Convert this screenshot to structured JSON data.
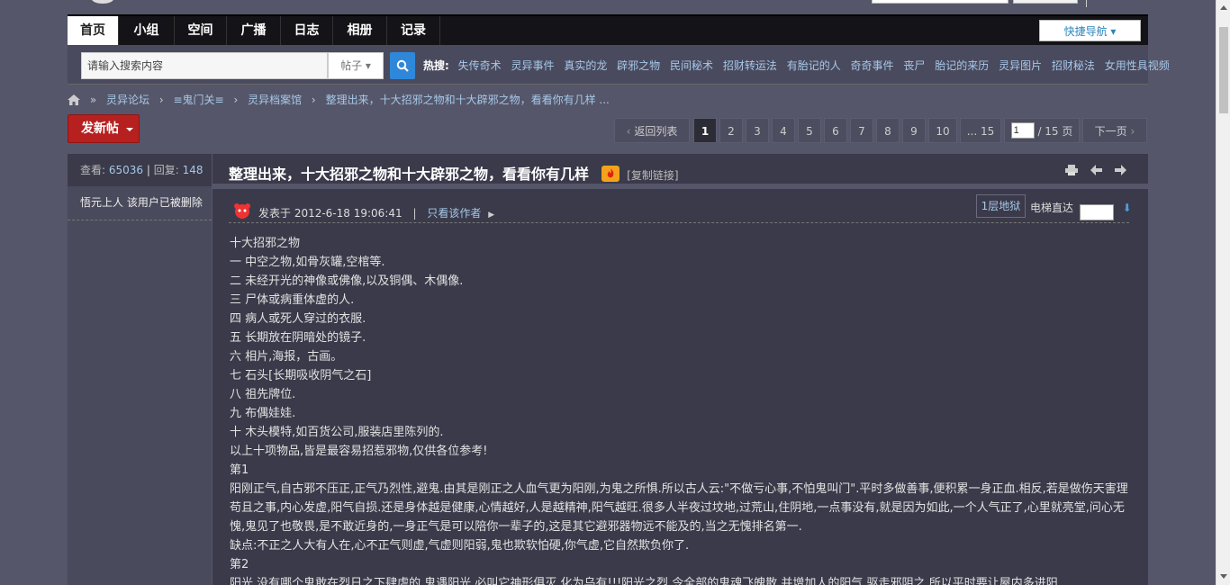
{
  "nav": {
    "tabs": [
      "首页",
      "小组",
      "空间",
      "广播",
      "日志",
      "相册",
      "记录"
    ],
    "quick_nav": "快捷导航"
  },
  "search": {
    "placeholder": "请输入搜索内容",
    "type": "帖子",
    "hot_label": "热搜:",
    "hot_keywords": [
      "失传奇术",
      "灵异事件",
      "真实的龙",
      "辟邪之物",
      "民间秘术",
      "招财转运法",
      "有胎记的人",
      "奇奇事件",
      "丧尸",
      "胎记的来历",
      "灵异图片",
      "招财秘法",
      "女用性具视频"
    ]
  },
  "breadcrumb": [
    "灵异论坛",
    "≡鬼门关≡",
    "灵异档案馆",
    "整理出来，十大招邪之物和十大辟邪之物，看看你有几样 ..."
  ],
  "new_post": "发新帖",
  "pager": {
    "back": "返回列表",
    "pages": [
      "1",
      "2",
      "3",
      "4",
      "5",
      "6",
      "7",
      "8",
      "9",
      "10",
      "... 15"
    ],
    "current": "1",
    "input_value": "1",
    "total": "/ 15 页",
    "next": "下一页"
  },
  "side": {
    "views_label": "查看:",
    "views": "65036",
    "replies_label": "回复:",
    "replies": "148",
    "author": "悟元上人 该用户已被删除"
  },
  "thread": {
    "title": "整理出来，十大招邪之物和十大辟邪之物，看看你有几样",
    "copy_link": "[复制链接]",
    "posted": "发表于 2012-6-18 19:06:41",
    "only_author": "只看该作者",
    "floor": "1层地狱",
    "elevator": "电梯直达"
  },
  "content": [
    "十大招邪之物",
    "一 中空之物,如骨灰罐,空棺等.",
    "二 未经开光的神像或佛像,以及铜偶、木偶像.",
    "三 尸体或病重体虚的人.",
    "四 病人或死人穿过的衣服.",
    "五 长期放在阴暗处的镜子.",
    "六 相片,海报，古画。",
    "七 石头[长期吸收阴气之石]",
    "八 祖先牌位.",
    "九 布偶娃娃.",
    "十 木头模特,如百货公司,服装店里陈列的.",
    "以上十项物品,皆是最容易招惹邪物,仅供各位参考!",
    "第1",
    "阳刚正气,自古邪不压正,正气乃烈性,避鬼.由其是刚正之人血气更为阳刚,为鬼之所惧.所以古人云:\"不做亏心事,不怕鬼叫门\".平时多做善事,便积累一身正血.相反,若是做伤天害理苟且之事,内心发虚,阳气自损.还是身体越是健康,心情越好,人是越精神,阳气越旺.很多人半夜过坟地,过荒山,住阴地,一点事没有,就是因为如此,一个人气正了,心里就亮堂,问心无愧,鬼见了也敬畏,是不敢近身的,一身正气是可以陪你一辈子的,这是其它避邪器物远不能及的,当之无愧排名第一.",
    "缺点:不正之人大有人在,心不正气则虚,气虚则阳弱,鬼也欺软怕硬,你气虚,它自然欺负你了.",
    "第2",
    "阳光,没有哪个鬼敢在烈日之下肆虐的,鬼遇阳光,必叫它神形俱灭,化为乌有!!!阳光之烈,令全部的鬼魂飞魄散,并增加人的阳气,驱走邪阴之.所以平时要让屋内多进阳"
  ]
}
